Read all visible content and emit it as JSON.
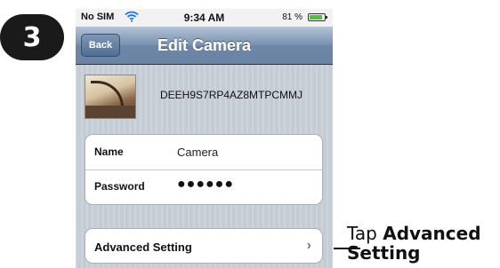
{
  "step": "3",
  "statusbar": {
    "carrier": "No SIM",
    "wifi_icon": "wifi-icon",
    "time": "9:34 AM",
    "battery": "81 %",
    "battery_icon": "battery-icon"
  },
  "navbar": {
    "back_label": "Back",
    "title": "Edit Camera"
  },
  "camera": {
    "id": "DEEH9S7RP4AZ8MTPCMMJ",
    "thumbnail": "camera-thumbnail"
  },
  "fields": {
    "name_label": "Name",
    "name_value": "Camera",
    "password_label": "Password",
    "password_value": "●●●●●●"
  },
  "advanced": {
    "label": "Advanced Setting",
    "chevron": "›"
  },
  "callout": {
    "prefix": "Tap ",
    "bold": "Advanced Setting"
  }
}
